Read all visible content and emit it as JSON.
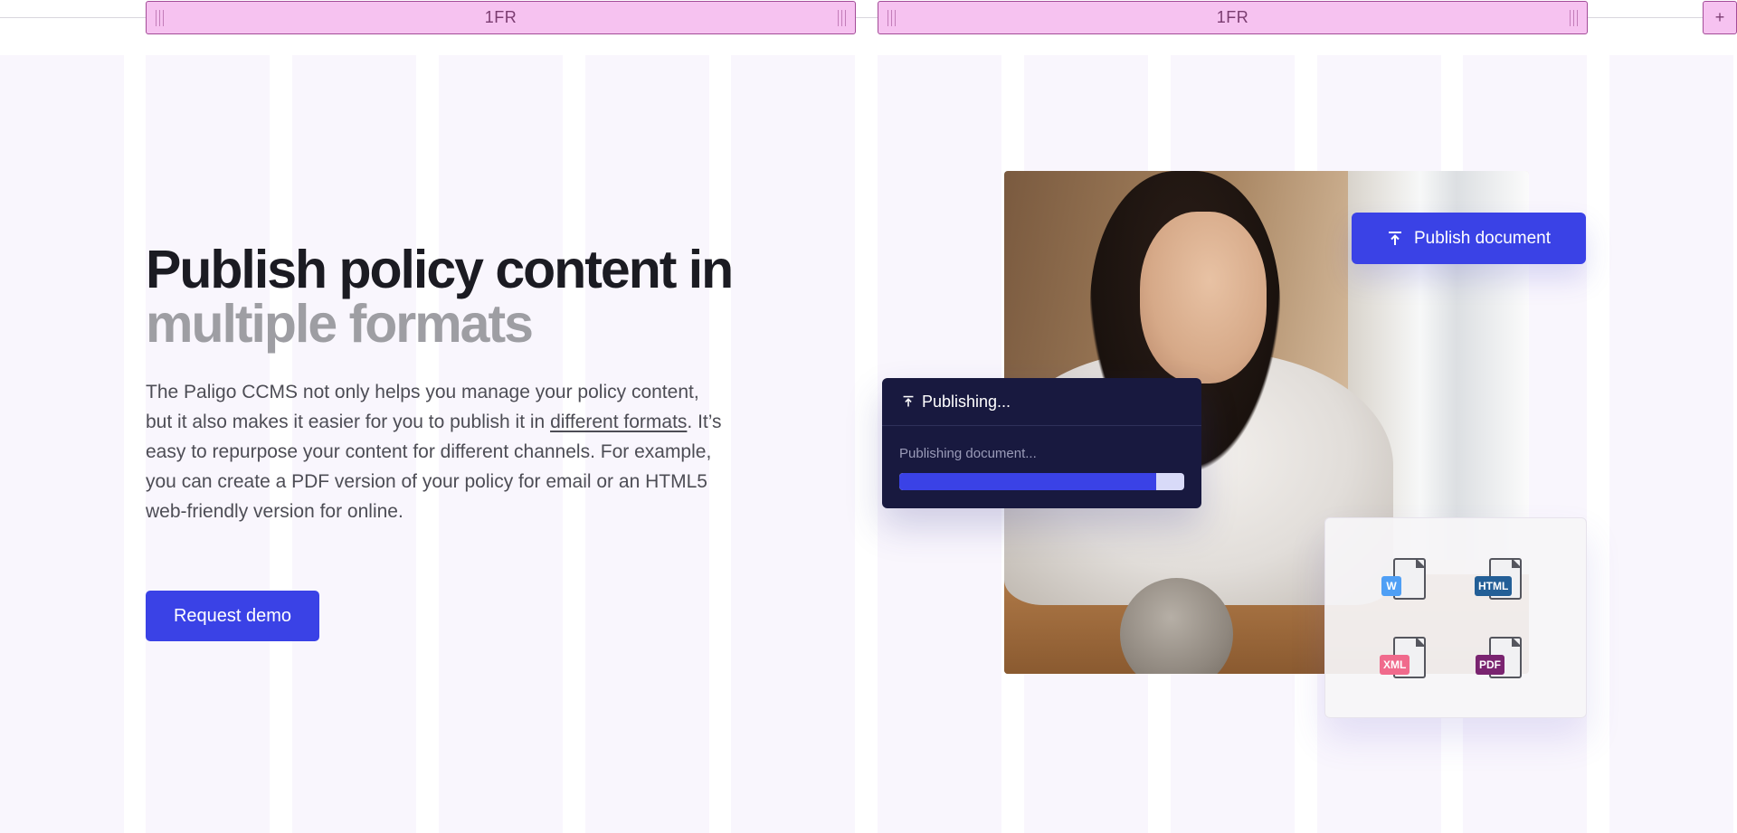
{
  "grid": {
    "tracks": [
      {
        "label": "1FR"
      },
      {
        "label": "1FR"
      }
    ],
    "add_label": "+"
  },
  "hero": {
    "headline_line1": "Publish policy content in",
    "headline_line2": "multiple formats",
    "body_part1": "The Paligo CCMS not only helps you manage your policy content, but it also makes it easier for you to publish it in ",
    "body_link": "different formats",
    "body_part2": ". It’s easy to repurpose your content for different channels. For example, you can create a PDF version of your policy for email or an HTML5 web-friendly version for online.",
    "cta_label": "Request demo"
  },
  "publish_button": {
    "label": "Publish document",
    "icon": "upload-icon"
  },
  "publishing_panel": {
    "title": "Publishing...",
    "subtitle": "Publishing document...",
    "progress": 0.9
  },
  "formats": [
    {
      "label": "W",
      "color": "#4f9ff5"
    },
    {
      "label": "HTML",
      "color": "#235f97"
    },
    {
      "label": "XML",
      "color": "#f06a8c"
    },
    {
      "label": "PDF",
      "color": "#7a2470"
    }
  ],
  "colors": {
    "accent": "#3a42e6",
    "panel_dark": "#18193f",
    "grid_track": "#f6c2f0"
  }
}
